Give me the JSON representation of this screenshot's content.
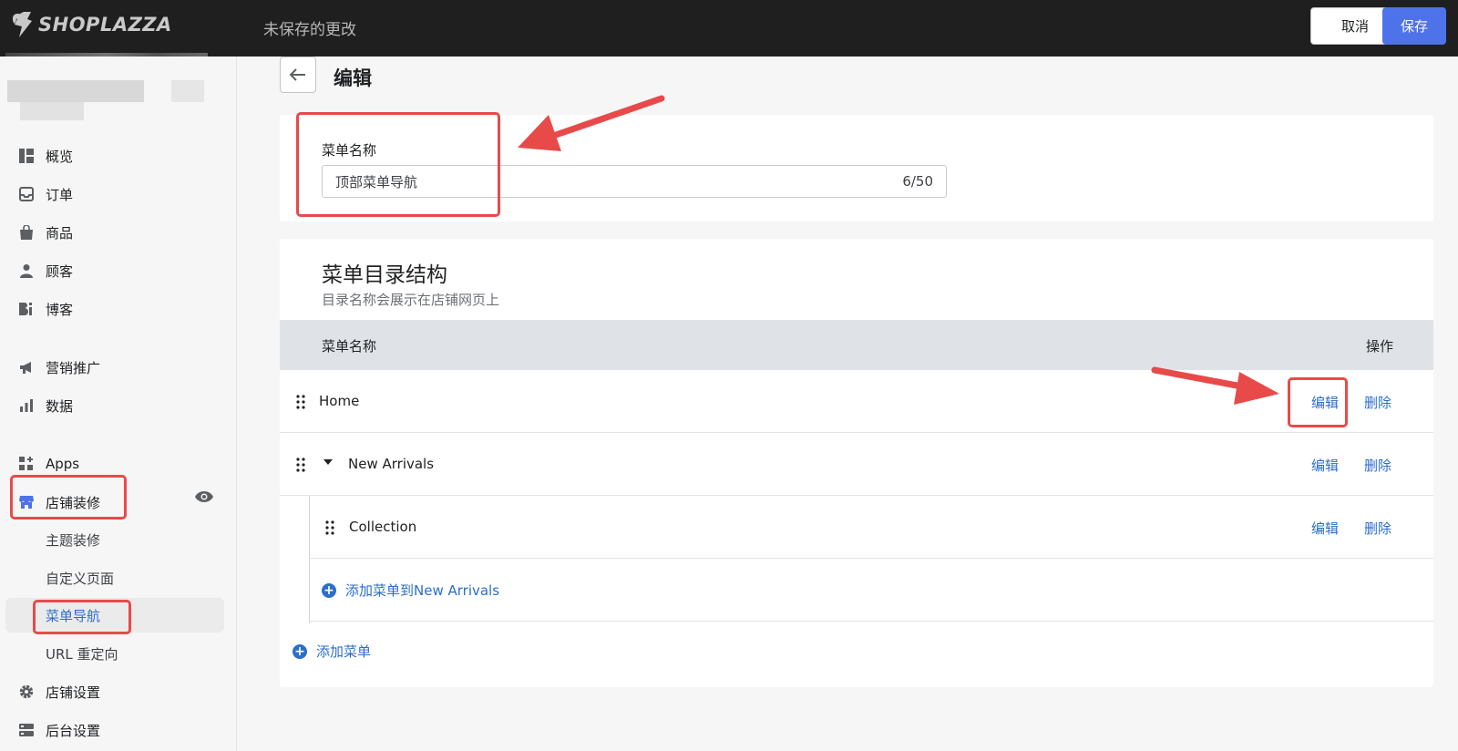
{
  "topbar": {
    "logo_text": "SHOPLAZZA",
    "unsaved_text": "未保存的更改",
    "cancel_label": "取消",
    "save_label": "保存"
  },
  "sidebar": {
    "items": [
      {
        "label": "概览",
        "icon": "overview-icon"
      },
      {
        "label": "订单",
        "icon": "inbox-icon"
      },
      {
        "label": "商品",
        "icon": "bag-icon"
      },
      {
        "label": "顾客",
        "icon": "person-icon"
      },
      {
        "label": "博客",
        "icon": "blog-icon"
      },
      {
        "label": "营销推广",
        "icon": "megaphone-icon"
      },
      {
        "label": "数据",
        "icon": "bar-chart-icon"
      },
      {
        "label": "Apps",
        "icon": "apps-icon"
      },
      {
        "label": "店铺装修",
        "icon": "store-icon"
      },
      {
        "label": "店铺设置",
        "icon": "gear-icon"
      },
      {
        "label": "后台设置",
        "icon": "server-icon"
      }
    ],
    "subitems": [
      {
        "label": "主题装修"
      },
      {
        "label": "自定义页面"
      },
      {
        "label": "菜单导航",
        "active": true
      },
      {
        "label": "URL 重定向"
      }
    ]
  },
  "page": {
    "title": "编辑"
  },
  "menu_name": {
    "label": "菜单名称",
    "value": "顶部菜单导航",
    "counter": "6/50"
  },
  "structure": {
    "title": "菜单目录结构",
    "description": "目录名称会展示在店铺网页上",
    "col_name": "菜单名称",
    "col_action": "操作",
    "rows": [
      {
        "name": "Home",
        "edit": "编辑",
        "delete": "删除"
      },
      {
        "name": "New Arrivals",
        "edit": "编辑",
        "delete": "删除"
      },
      {
        "name": "Collection",
        "edit": "编辑",
        "delete": "删除"
      }
    ],
    "add_sub_label": "添加菜单到New Arrivals",
    "add_label": "添加菜单"
  },
  "colors": {
    "accent": "#4e72ea",
    "link": "#2c6ecb",
    "annotation": "#e84a4a",
    "topbar": "#1f1f1f"
  }
}
